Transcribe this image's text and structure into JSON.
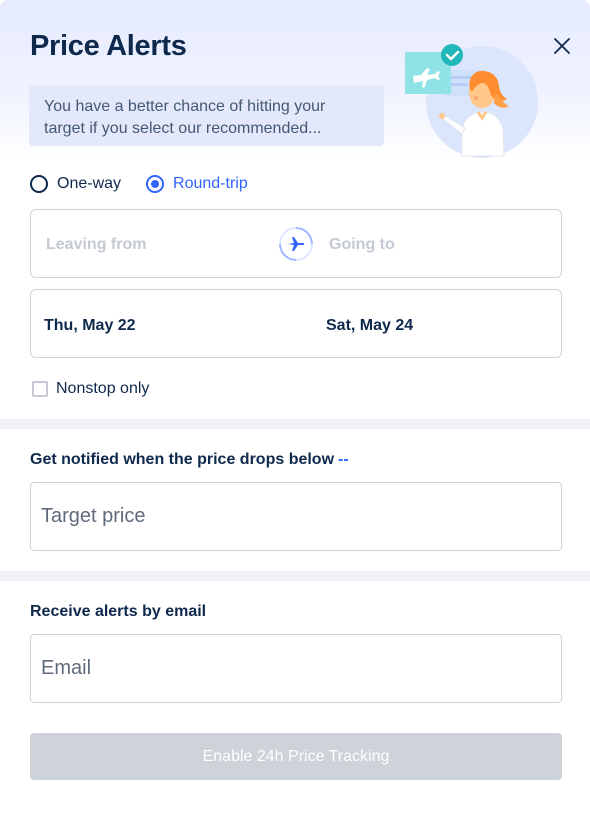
{
  "header": {
    "title": "Price Alerts",
    "tip": "You have a better chance of hitting your target if you select our recommended..."
  },
  "trip_type": {
    "options": [
      {
        "label": "One-way",
        "selected": false
      },
      {
        "label": "Round-trip",
        "selected": true
      }
    ]
  },
  "route": {
    "from_placeholder": "Leaving from",
    "to_placeholder": "Going to"
  },
  "dates": {
    "depart": "Thu, May 22",
    "return": "Sat, May 24"
  },
  "nonstop": {
    "label": "Nonstop only",
    "checked": false
  },
  "price_section": {
    "label": "Get notified when the price drops below",
    "value": "--",
    "placeholder": "Target price"
  },
  "email_section": {
    "label": "Receive alerts by email",
    "placeholder": "Email"
  },
  "submit": {
    "label": "Enable 24h Price Tracking",
    "enabled": false
  },
  "colors": {
    "accent": "#3264ff",
    "text": "#0f294d",
    "border": "#ced2d9",
    "disabled": "#ced2d9",
    "header_bg": "#e6ebff",
    "teal": "#20c5c5"
  },
  "icons": {
    "close": "close-icon",
    "swap": "plane-icon",
    "illustration": "price-alert-illustration"
  }
}
